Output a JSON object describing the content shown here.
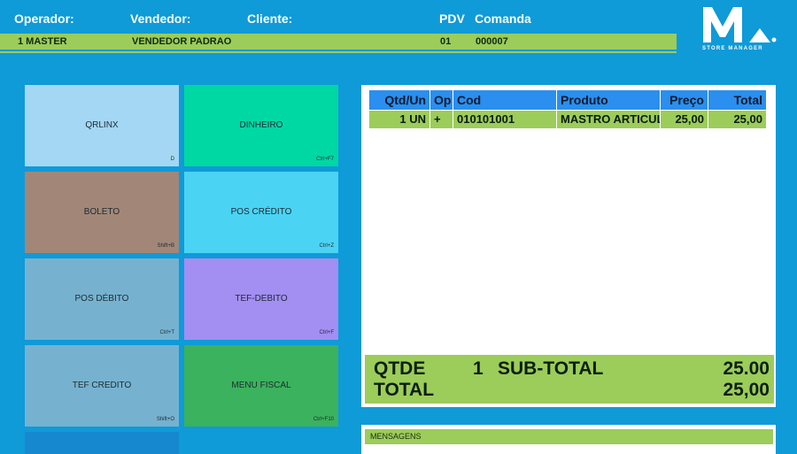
{
  "header": {
    "operador_label": "Operador:",
    "vendedor_label": "Vendedor:",
    "cliente_label": "Cliente:",
    "pdv_label": "PDV",
    "comanda_label": "Comanda",
    "operador_value": "1 MASTER",
    "vendedor_value": "VENDEDOR PADRAO",
    "cliente_value": "",
    "pdv_value": "01",
    "comanda_value": "000007"
  },
  "logo": {
    "mark": "M",
    "subtitle": "STORE MANAGER"
  },
  "payment_buttons": [
    {
      "label": "QRLINX",
      "shortcut": "D",
      "color": "#a3d7f3"
    },
    {
      "label": "DINHEIRO",
      "shortcut": "Ctrl+F7",
      "color": "#00d8a4"
    },
    {
      "label": "BOLETO",
      "shortcut": "Shift+B",
      "color": "#a28778"
    },
    {
      "label": "POS CRÉDITO",
      "shortcut": "Ctrl+Z",
      "color": "#4bd3f4"
    },
    {
      "label": "POS DÉBITO",
      "shortcut": "Ctrl+T",
      "color": "#76b2cf"
    },
    {
      "label": "TEF-DEBITO",
      "shortcut": "Ctrl+F",
      "color": "#a38ef2"
    },
    {
      "label": "TEF CREDITO",
      "shortcut": "Shift+O",
      "color": "#76b2cf"
    },
    {
      "label": "MENU FISCAL",
      "shortcut": "Ctrl+F10",
      "color": "#3bb25d"
    }
  ],
  "items_table": {
    "columns": [
      "Qtd/Un",
      "Op",
      "Cod",
      "Produto",
      "Preço",
      "Total"
    ],
    "rows": [
      [
        "1 UN",
        "+",
        "010101001",
        "MASTRO ARTICUL",
        "25,00",
        "25,00"
      ]
    ]
  },
  "totals": {
    "qtde_label": "QTDE",
    "qtde_value": "1",
    "subtotal_label": "SUB-TOTAL",
    "subtotal_value": "25.00",
    "total_label": "TOTAL",
    "total_value": "25,00"
  },
  "messages": {
    "label": "MENSAGENS"
  }
}
